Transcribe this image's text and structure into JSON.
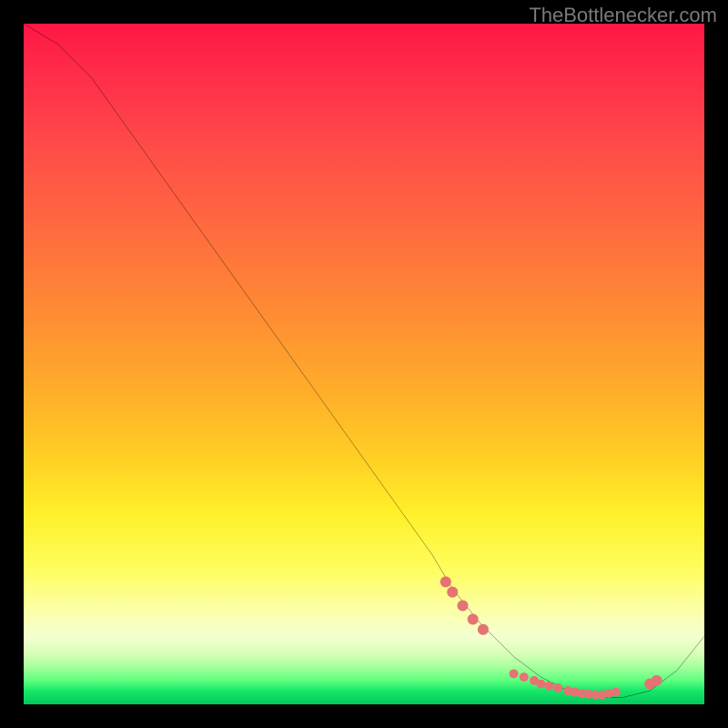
{
  "watermark": "TheBottlenecker.com",
  "chart_data": {
    "type": "line",
    "title": "",
    "xlabel": "",
    "ylabel": "",
    "xlim": [
      0,
      100
    ],
    "ylim": [
      0,
      100
    ],
    "series": [
      {
        "name": "curve",
        "color": "#000000",
        "x": [
          0,
          5,
          10,
          15,
          20,
          25,
          30,
          35,
          40,
          45,
          50,
          55,
          60,
          63,
          67,
          72,
          76,
          80,
          84,
          88,
          92,
          96,
          100
        ],
        "y": [
          100,
          97,
          92,
          85,
          78,
          71,
          64,
          57,
          50,
          43,
          36,
          29,
          22,
          17,
          12,
          7,
          4,
          2,
          1,
          1,
          2,
          5,
          10
        ]
      }
    ],
    "markers": [
      {
        "name": "cluster-left",
        "color": "#e57373",
        "r": 6,
        "points": [
          [
            62,
            18
          ],
          [
            63,
            16.5
          ],
          [
            64.5,
            14.5
          ],
          [
            66,
            12.5
          ],
          [
            67.5,
            11
          ]
        ]
      },
      {
        "name": "cluster-bottom",
        "color": "#e57373",
        "r": 5,
        "points": [
          [
            72,
            4.5
          ],
          [
            73.5,
            4
          ],
          [
            75,
            3.5
          ],
          [
            76,
            3
          ],
          [
            77.2,
            2.7
          ],
          [
            78.5,
            2.4
          ],
          [
            80,
            2
          ],
          [
            81,
            1.8
          ],
          [
            82,
            1.6
          ],
          [
            83,
            1.5
          ],
          [
            84,
            1.4
          ],
          [
            85,
            1.4
          ],
          [
            86,
            1.6
          ],
          [
            87,
            1.8
          ]
        ]
      },
      {
        "name": "cluster-right",
        "color": "#e57373",
        "r": 6,
        "points": [
          [
            92,
            3
          ],
          [
            93,
            3.5
          ]
        ]
      }
    ],
    "gradient_stops": [
      {
        "pos": 0,
        "color": "#ff1744"
      },
      {
        "pos": 0.5,
        "color": "#ffad2a"
      },
      {
        "pos": 0.8,
        "color": "#fffd5c"
      },
      {
        "pos": 0.95,
        "color": "#5dff7e"
      },
      {
        "pos": 1.0,
        "color": "#00c95a"
      }
    ]
  }
}
